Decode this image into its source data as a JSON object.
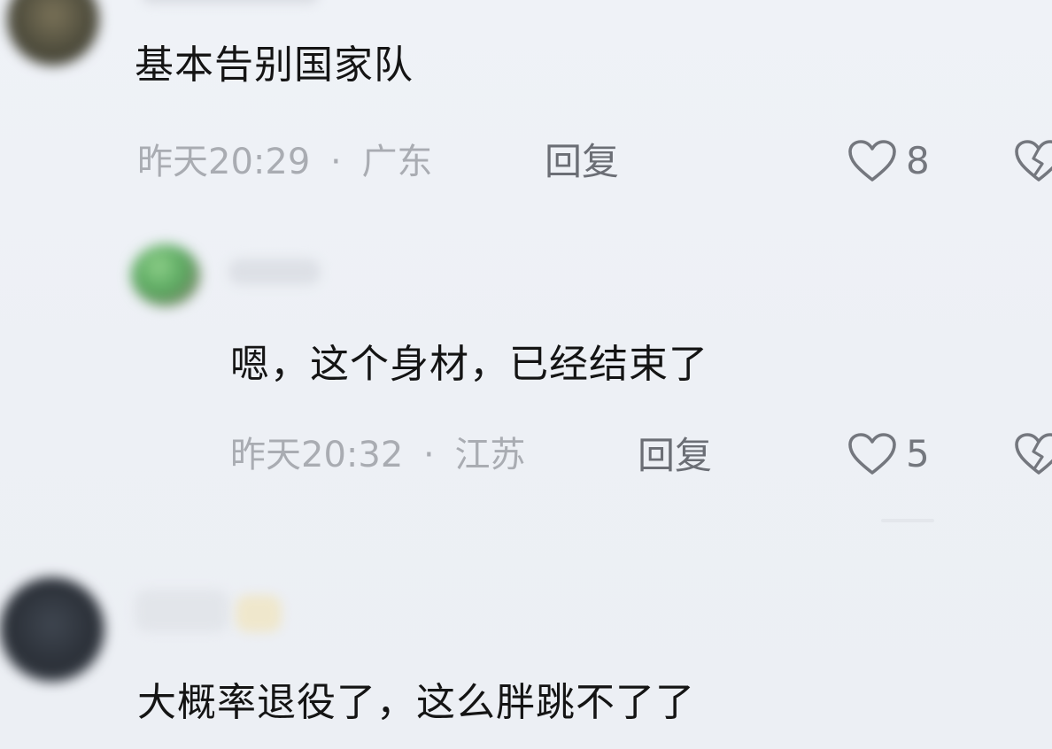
{
  "comments": [
    {
      "text": "基本告别国家队",
      "time": "昨天20:29",
      "separator": "·",
      "location": "广东",
      "reply_label": "回复",
      "likes": "8"
    },
    {
      "text": "嗯，这个身材，已经结束了",
      "time": "昨天20:32",
      "separator": "·",
      "location": "江苏",
      "reply_label": "回复",
      "likes": "5"
    },
    {
      "text": "大概率退役了，这么胖跳不了了"
    }
  ],
  "icons": {
    "like": "heart-outline-icon",
    "dislike": "broken-heart-icon"
  },
  "colors": {
    "background": "#eef1f6",
    "text": "#141414",
    "meta": "#a9acb2",
    "reply": "#6b6e75",
    "icon": "#74777e"
  }
}
